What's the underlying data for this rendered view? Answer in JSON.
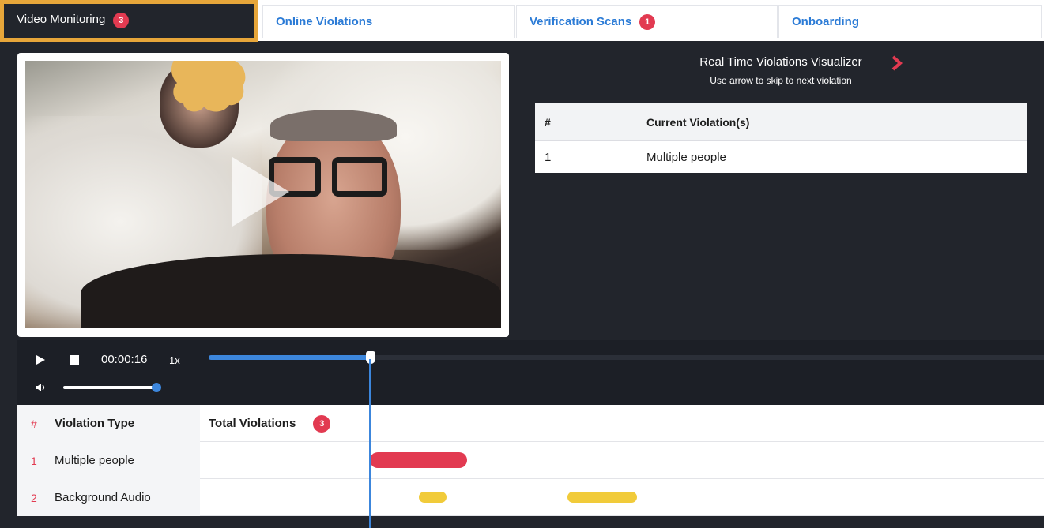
{
  "tabs": [
    {
      "label": "Video Monitoring",
      "badge": "3",
      "active": true
    },
    {
      "label": "Online Violations",
      "badge": null
    },
    {
      "label": "Verification Scans",
      "badge": "1"
    },
    {
      "label": "Onboarding",
      "badge": null
    }
  ],
  "visualizer": {
    "title": "Real Time Violations Visualizer",
    "subtitle": "Use arrow to skip to next violation",
    "table": {
      "headers": [
        "#",
        "Current Violation(s)"
      ],
      "rows": [
        [
          "1",
          "Multiple people"
        ]
      ]
    }
  },
  "player": {
    "time": "00:00:16",
    "speed": "1x",
    "progress_fraction": 0.194,
    "volume_fraction": 0.98
  },
  "timeline": {
    "header": {
      "num": "#",
      "type": "Violation Type",
      "total_label": "Total Violations",
      "total_badge": "3"
    },
    "rows": [
      {
        "num": "1",
        "type": "Multiple people"
      },
      {
        "num": "2",
        "type": "Background Audio"
      }
    ]
  },
  "colors": {
    "accent_blue": "#3c86dc",
    "badge_red": "#e23a51",
    "active_tab_border": "#e7a63a",
    "audio_yellow": "#f1cb3a",
    "dark_bg": "#22252c"
  },
  "icons": [
    "play-icon",
    "stop-icon",
    "volume-icon",
    "chevron-right-icon"
  ]
}
